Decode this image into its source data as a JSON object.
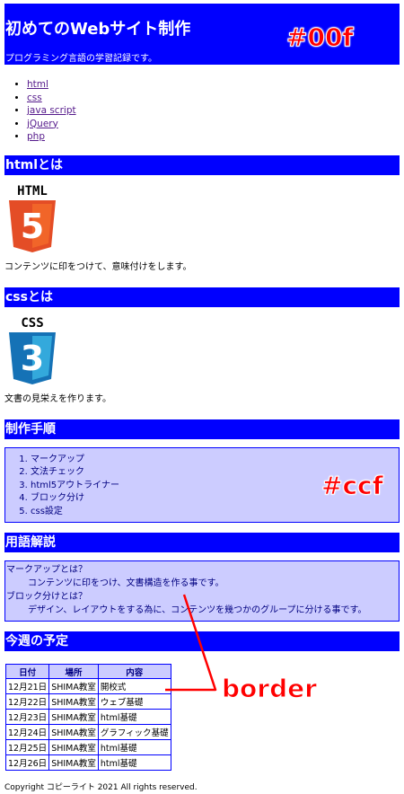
{
  "header": {
    "title": "初めてのWebサイト制作",
    "tagline": "プログラミング言語の学習記録です。"
  },
  "nav": {
    "items": [
      "html",
      "css",
      "java script",
      "jQuery",
      "php"
    ]
  },
  "html_section": {
    "heading": "htmlとは",
    "logo_text": "HTML",
    "logo_num": "5",
    "description": "コンテンツに印をつけて、意味付けをします。"
  },
  "css_section": {
    "heading": "cssとは",
    "logo_text": "CSS",
    "logo_num": "3",
    "description": "文書の見栄えを作ります。"
  },
  "procedure": {
    "heading": "制作手順",
    "steps": [
      "マークアップ",
      "文法チェック",
      "html5アウトライナー",
      "ブロック分け",
      "css設定"
    ]
  },
  "glossary": {
    "heading": "用語解説",
    "terms": [
      {
        "term": "マークアップとは？",
        "definition": "コンテンツに印をつけ、文書構造を作る事です。"
      },
      {
        "term": "ブロック分けとは？",
        "definition": "デザイン、レイアウトをする為に、コンテンツを幾つかのグループに分ける事です。"
      }
    ]
  },
  "schedule": {
    "heading": "今週の予定",
    "columns": [
      "日付",
      "場所",
      "内容"
    ],
    "rows": [
      [
        "12月21日",
        "SHIMA教室",
        "開校式"
      ],
      [
        "12月22日",
        "SHIMA教室",
        "ウェブ基礎"
      ],
      [
        "12月23日",
        "SHIMA教室",
        "html基礎"
      ],
      [
        "12月24日",
        "SHIMA教室",
        "グラフィック基礎"
      ],
      [
        "12月25日",
        "SHIMA教室",
        "html基礎"
      ],
      [
        "12月26日",
        "SHIMA教室",
        "html基礎"
      ]
    ]
  },
  "footer": {
    "text": "Copyright コピーライト 2021 All rights reserved."
  },
  "annotations": {
    "header_color": "#00f",
    "box_color": "#ccf",
    "border_label": "border"
  },
  "colors": {
    "primary": "#0000ff",
    "box_bg": "#ccccff",
    "annotation": "#ff0000",
    "html5": "#e44d26",
    "css3": "#1572b6"
  }
}
